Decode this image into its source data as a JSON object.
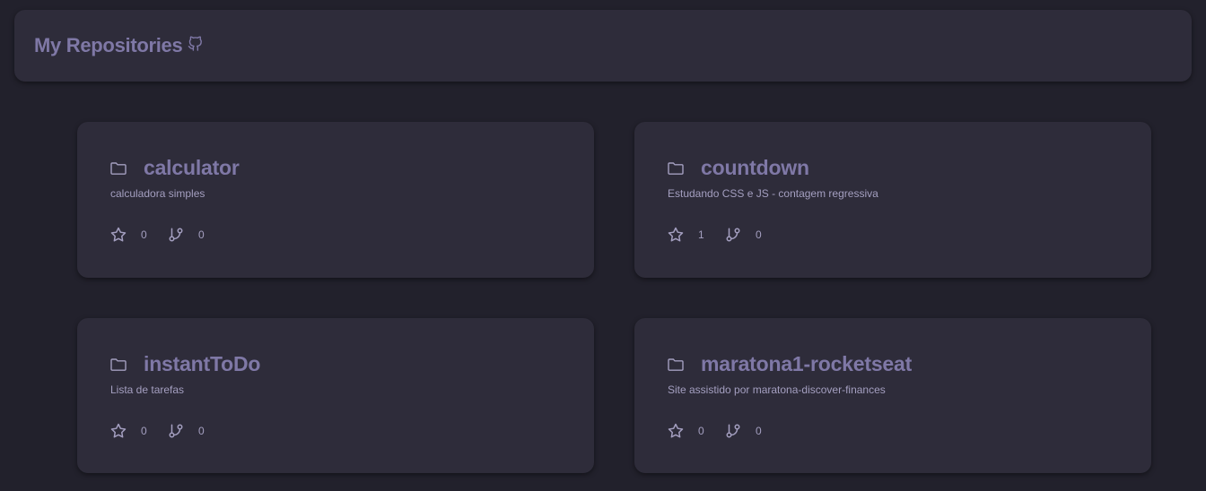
{
  "header": {
    "title": "My Repositories",
    "icon": "github-icon"
  },
  "colors": {
    "background": "#22212c",
    "card": "#2e2c3a",
    "accent": "#7f78a6",
    "text_muted": "#a49fc0"
  },
  "repos": [
    {
      "name": "calculator",
      "description": "calculadora simples",
      "stars": "0",
      "forks": "0"
    },
    {
      "name": "countdown",
      "description": "Estudando CSS e JS - contagem regressiva",
      "stars": "1",
      "forks": "0"
    },
    {
      "name": "instantToDo",
      "description": "Lista de tarefas",
      "stars": "0",
      "forks": "0"
    },
    {
      "name": "maratona1-rocketseat",
      "description": "Site assistido por maratona-discover-finances",
      "stars": "0",
      "forks": "0"
    }
  ]
}
